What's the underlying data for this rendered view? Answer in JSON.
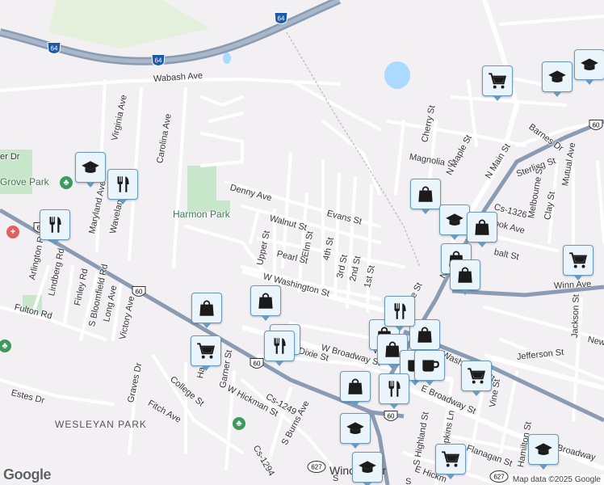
{
  "map": {
    "attribution": "Map data ©2025 Google",
    "logo": "Google",
    "colors": {
      "background": "#f2f0f3",
      "road": "#ffffff",
      "highway": "#8a9bb2",
      "park": "#c8e6c9",
      "water": "#aadaff",
      "pin_fill": "#eaf4fb",
      "pin_border": "#6a9bbd"
    }
  },
  "streets": [
    {
      "id": "wabash",
      "text": "Wabash Ave"
    },
    {
      "id": "virginia",
      "text": "Virginia Ave"
    },
    {
      "id": "carolina",
      "text": "Carolina Ave"
    },
    {
      "id": "denny",
      "text": "Denny Ave"
    },
    {
      "id": "walnut",
      "text": "Walnut St"
    },
    {
      "id": "evans",
      "text": "Evans St"
    },
    {
      "id": "elm",
      "text": "Elm St"
    },
    {
      "id": "upper",
      "text": "Upper St"
    },
    {
      "id": "pearl",
      "text": "Pearl St"
    },
    {
      "id": "4th",
      "text": "4th St"
    },
    {
      "id": "3rd",
      "text": "3rd St"
    },
    {
      "id": "2nd",
      "text": "2nd St"
    },
    {
      "id": "1st",
      "text": "1st St"
    },
    {
      "id": "wwash",
      "text": "W Washington St"
    },
    {
      "id": "maryland",
      "text": "Maryland Ave"
    },
    {
      "id": "waveland",
      "text": "Waveland Ave"
    },
    {
      "id": "arlington",
      "text": "Arlington Rd"
    },
    {
      "id": "lindberg",
      "text": "Lindberg Rd"
    },
    {
      "id": "finley",
      "text": "Finley Rd"
    },
    {
      "id": "sbloom",
      "text": "S Bloomfield Rd"
    },
    {
      "id": "long",
      "text": "Long Ave"
    },
    {
      "id": "victory",
      "text": "Victory Ave"
    },
    {
      "id": "fulton",
      "text": "Fulton Rd"
    },
    {
      "id": "estes",
      "text": "Estes Dr"
    },
    {
      "id": "graves",
      "text": "Graves Dr"
    },
    {
      "id": "fitch",
      "text": "Fitch Ave"
    },
    {
      "id": "college",
      "text": "College St"
    },
    {
      "id": "garner",
      "text": "Garner St"
    },
    {
      "id": "whickman",
      "text": "W Hickman St"
    },
    {
      "id": "cs1249",
      "text": "Cs-1249"
    },
    {
      "id": "sburns",
      "text": "S Burns Ave"
    },
    {
      "id": "cs1294",
      "text": "Cs-1294"
    },
    {
      "id": "dixie",
      "text": "Dixie St"
    },
    {
      "id": "wbroadway",
      "text": "W Broadway St"
    },
    {
      "id": "cherry",
      "text": "Cherry St"
    },
    {
      "id": "magnolia",
      "text": "Magnolia St"
    },
    {
      "id": "nmaple",
      "text": "N Maple St"
    },
    {
      "id": "nmain",
      "text": "N Main St"
    },
    {
      "id": "barnes",
      "text": "Barnes Dr"
    },
    {
      "id": "sterling",
      "text": "Sterling St"
    },
    {
      "id": "mutual",
      "text": "Mutual Ave"
    },
    {
      "id": "cs1326",
      "text": "Cs-1326"
    },
    {
      "id": "melbourne",
      "text": "Melbourne St"
    },
    {
      "id": "clay",
      "text": "Clay St"
    },
    {
      "id": "ook",
      "text": "ook Ave"
    },
    {
      "id": "balt",
      "text": "balt St"
    },
    {
      "id": "winn",
      "text": "Winn Ave"
    },
    {
      "id": "jackson",
      "text": "Jackson St"
    },
    {
      "id": "new",
      "text": "New"
    },
    {
      "id": "jefferson",
      "text": "Jefferson St"
    },
    {
      "id": "ewash",
      "text": "Washington St"
    },
    {
      "id": "ebroadway",
      "text": "E Broadway St"
    },
    {
      "id": "vine",
      "text": "Vine St"
    },
    {
      "id": "shighland",
      "text": "S Highland St"
    },
    {
      "id": "hopkins",
      "text": "Hopkins Ln"
    },
    {
      "id": "flanagan",
      "text": "Flanagan St"
    },
    {
      "id": "hamilton",
      "text": "Hamilton St"
    },
    {
      "id": "broadway2",
      "text": "Broadway"
    },
    {
      "id": "ehick",
      "text": "E Hickm"
    },
    {
      "id": "erdr",
      "text": "er Dr"
    },
    {
      "id": "ha",
      "text": "Ha"
    },
    {
      "id": "nma",
      "text": "N Ma"
    },
    {
      "id": "lest",
      "text": "le St"
    },
    {
      "id": "sfrag",
      "text": "S"
    },
    {
      "id": "ws",
      "text": "W"
    },
    {
      "id": "sts",
      "text": "S"
    }
  ],
  "places": [
    {
      "id": "grovepark",
      "text": "Grove Park"
    },
    {
      "id": "harmonpark",
      "text": "Harmon Park"
    },
    {
      "id": "wesleyan",
      "text": "WESLEYAN PARK"
    },
    {
      "id": "winchester",
      "text": "Winchester"
    }
  ],
  "route_shields": [
    {
      "id": "i64a",
      "text": "64",
      "type": "interstate"
    },
    {
      "id": "i64b",
      "text": "64",
      "type": "interstate"
    },
    {
      "id": "i64c",
      "text": "64",
      "type": "interstate"
    },
    {
      "id": "us60a",
      "text": "60",
      "type": "us"
    },
    {
      "id": "us60b",
      "text": "60",
      "type": "us"
    },
    {
      "id": "us60c",
      "text": "60",
      "type": "us"
    },
    {
      "id": "us60d",
      "text": "60",
      "type": "us"
    },
    {
      "id": "us60e",
      "text": "60",
      "type": "us"
    },
    {
      "id": "r627a",
      "text": "627",
      "type": "state"
    },
    {
      "id": "r627b",
      "text": "627",
      "type": "state"
    }
  ],
  "markers": [
    {
      "id": "m1",
      "icon": "school"
    },
    {
      "id": "m2",
      "icon": "restaurant"
    },
    {
      "id": "m3",
      "icon": "restaurant"
    },
    {
      "id": "m4",
      "icon": "grocery"
    },
    {
      "id": "m5",
      "icon": "school"
    },
    {
      "id": "m6",
      "icon": "school"
    },
    {
      "id": "m7",
      "icon": "shopping"
    },
    {
      "id": "m8",
      "icon": "school"
    },
    {
      "id": "m9",
      "icon": "shopping"
    },
    {
      "id": "m10",
      "icon": "shopping"
    },
    {
      "id": "m11",
      "icon": "grocery"
    },
    {
      "id": "m12",
      "icon": "shopping"
    },
    {
      "id": "m13",
      "icon": "shopping"
    },
    {
      "id": "m14",
      "icon": "grocery"
    },
    {
      "id": "m15",
      "icon": "restaurant"
    },
    {
      "id": "m16",
      "icon": "restaurant"
    },
    {
      "id": "m17",
      "icon": "shopping"
    },
    {
      "id": "m18",
      "icon": "shopping"
    },
    {
      "id": "m19",
      "icon": "shopping"
    },
    {
      "id": "m20",
      "icon": "cafe"
    },
    {
      "id": "m21",
      "icon": "cafe"
    },
    {
      "id": "m22",
      "icon": "grocery"
    },
    {
      "id": "m23",
      "icon": "restaurant"
    },
    {
      "id": "m24",
      "icon": "school"
    },
    {
      "id": "m25",
      "icon": "school"
    },
    {
      "id": "m26",
      "icon": "grocery"
    },
    {
      "id": "m27",
      "icon": "school"
    }
  ]
}
